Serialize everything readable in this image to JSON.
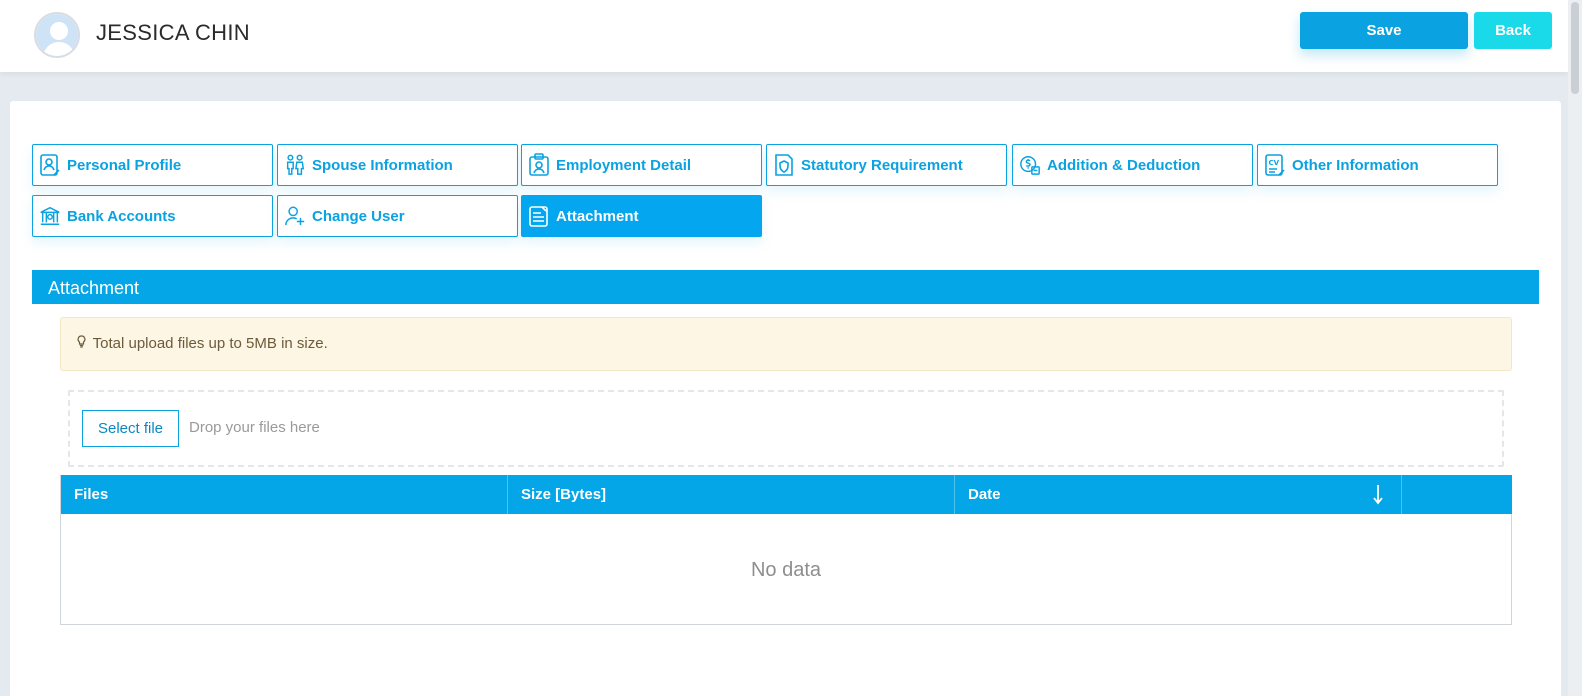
{
  "header": {
    "user_name": "JESSICA CHIN",
    "save_label": "Save",
    "back_label": "Back"
  },
  "tabs": [
    {
      "label": "Personal Profile",
      "icon": "personal-profile-icon",
      "active": false
    },
    {
      "label": "Spouse Information",
      "icon": "spouse-icon",
      "active": false
    },
    {
      "label": "Employment Detail",
      "icon": "employment-icon",
      "active": false
    },
    {
      "label": "Statutory Requirement",
      "icon": "statutory-icon",
      "active": false
    },
    {
      "label": "Addition & Deduction",
      "icon": "addition-deduction-icon",
      "active": false
    },
    {
      "label": "Other Information",
      "icon": "cv-icon",
      "active": false
    },
    {
      "label": "Bank Accounts",
      "icon": "bank-icon",
      "active": false
    },
    {
      "label": "Change User",
      "icon": "add-user-icon",
      "active": false
    },
    {
      "label": "Attachment",
      "icon": "attachment-icon",
      "active": true
    }
  ],
  "section": {
    "title": "Attachment"
  },
  "notice": {
    "text": "Total upload files up to 5MB in size."
  },
  "upload": {
    "select_label": "Select file",
    "drop_hint": "Drop your files here"
  },
  "table": {
    "columns": [
      "Files",
      "Size [Bytes]",
      "Date",
      ""
    ],
    "rows": [],
    "empty_text": "No data"
  },
  "colors": {
    "accent": "#04a6e7",
    "back_button": "#1ad9e8",
    "notice_bg": "#fdf6e4"
  }
}
